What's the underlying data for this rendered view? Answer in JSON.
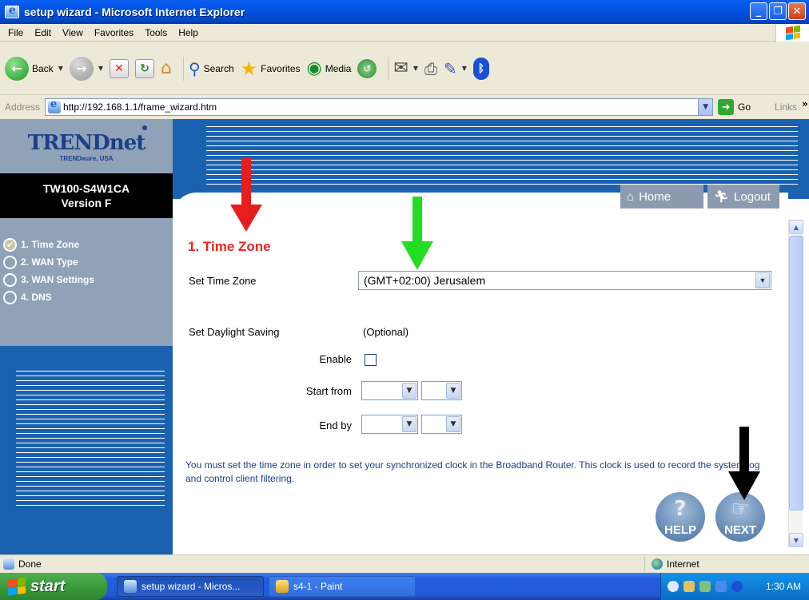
{
  "window": {
    "title": "setup wizard - Microsoft Internet Explorer",
    "controls": [
      "minimize",
      "maximize",
      "close"
    ]
  },
  "menu": [
    "File",
    "Edit",
    "View",
    "Favorites",
    "Tools",
    "Help"
  ],
  "toolbar": {
    "back": "Back",
    "search": "Search",
    "favorites": "Favorites",
    "media": "Media"
  },
  "address": {
    "label": "Address",
    "url": "http://192.168.1.1/frame_wizard.htm",
    "go": "Go",
    "links": "Links"
  },
  "sidebar": {
    "logo": "TRENDnet",
    "logo_sub": "TRENDware, USA",
    "model": "TW100-S4W1CA",
    "version": "Version F",
    "steps": [
      {
        "label": "1. Time Zone",
        "done": true
      },
      {
        "label": "2. WAN Type",
        "done": false
      },
      {
        "label": "3. WAN Settings",
        "done": false
      },
      {
        "label": "4. DNS",
        "done": false
      }
    ]
  },
  "header": {
    "home": "Home",
    "logout": "Logout"
  },
  "form": {
    "title": "1. Time Zone",
    "set_time_zone_label": "Set Time Zone",
    "time_zone_value": "(GMT+02:00) Jerusalem",
    "daylight_label": "Set Daylight Saving",
    "optional": "(Optional)",
    "enable_label": "Enable",
    "enable_checked": false,
    "start_from_label": "Start from",
    "end_by_label": "End by",
    "info": "You must set the time zone in order to set your synchronized clock in the Broadband Router. This clock is used to record the system log and control client filtering.",
    "help": "HELP",
    "next": "NEXT"
  },
  "annotations": {
    "arrow_colors": [
      "#e81e1e",
      "#22dd22",
      "#000000"
    ]
  },
  "status": {
    "left": "Done",
    "zone": "Internet"
  },
  "taskbar": {
    "start": "start",
    "tasks": [
      "setup wizard - Micros...",
      "s4-1 - Paint"
    ],
    "clock": "1:30 AM"
  }
}
